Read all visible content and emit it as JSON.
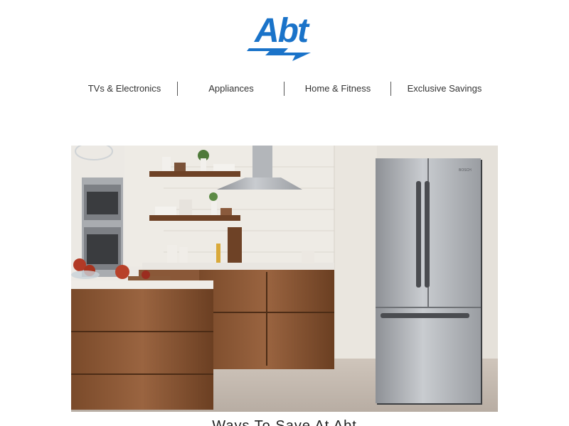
{
  "brand": {
    "logo_text": "Abt",
    "color": "#1a73c9"
  },
  "nav": {
    "items": [
      {
        "label": "TVs & Electronics"
      },
      {
        "label": "Appliances"
      },
      {
        "label": "Home & Fitness"
      },
      {
        "label": "Exclusive Savings"
      }
    ]
  },
  "hero": {
    "alt": "Modern kitchen with walnut cabinets and stainless steel French door refrigerator",
    "fridge_brand": "BOSCH"
  },
  "caption": {
    "text": "Ways To Save At Abt"
  }
}
